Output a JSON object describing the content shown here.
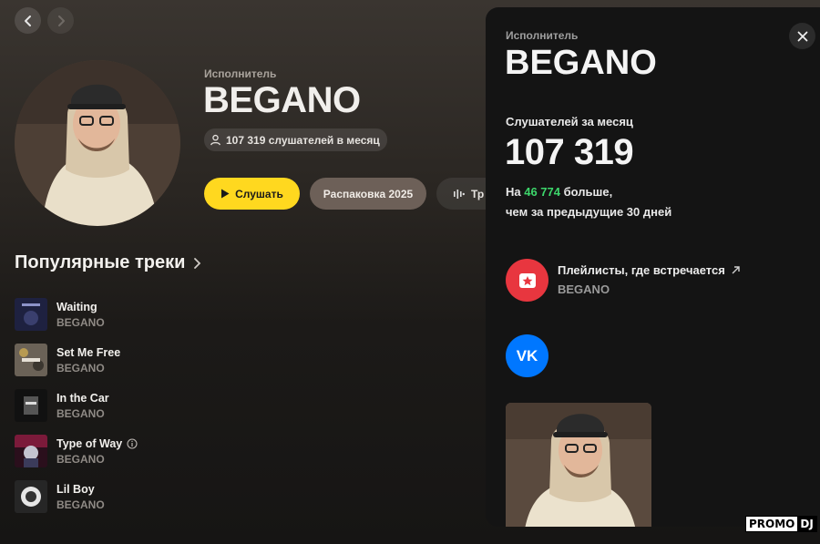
{
  "nav": {
    "back_icon": "chevron-left-icon",
    "forward_icon": "chevron-right-icon"
  },
  "header": {
    "kicker": "Исполнитель",
    "artist": "BEGANO",
    "listeners": "107 319 слушателей в месяц",
    "play_label": "Слушать",
    "unpack_label": "Распаковка 2025",
    "third_label": "Тр"
  },
  "popular": {
    "title": "Популярные треки",
    "tracks": [
      {
        "title": "Waiting",
        "artist": "BEGANO",
        "info": false
      },
      {
        "title": "Set Me Free",
        "artist": "BEGANO",
        "info": false
      },
      {
        "title": "In the Car",
        "artist": "BEGANO",
        "info": false
      },
      {
        "title": "Type of Way",
        "artist": "BEGANO",
        "info": true
      },
      {
        "title": "Lil Boy",
        "artist": "BEGANO",
        "info": false
      }
    ]
  },
  "panel": {
    "kicker": "Исполнитель",
    "artist": "BEGANO",
    "monthly_label": "Слушателей за месяц",
    "monthly_value": "107 319",
    "delta_prefix": "На ",
    "delta_value": "46 774",
    "delta_suffix": " больше,",
    "delta_line2": "чем за предыдущие 30 дней",
    "playlists_title": "Плейлисты, где встречается",
    "playlists_sub": "BEGANO",
    "vk_label": "VK"
  },
  "watermark": {
    "part1": "PROMO",
    "part2": "DJ"
  },
  "colors": {
    "accent_yellow": "#ffd81f",
    "delta_green": "#3dd66b",
    "playlist_red": "#e8363f",
    "vk_blue": "#0077ff"
  }
}
